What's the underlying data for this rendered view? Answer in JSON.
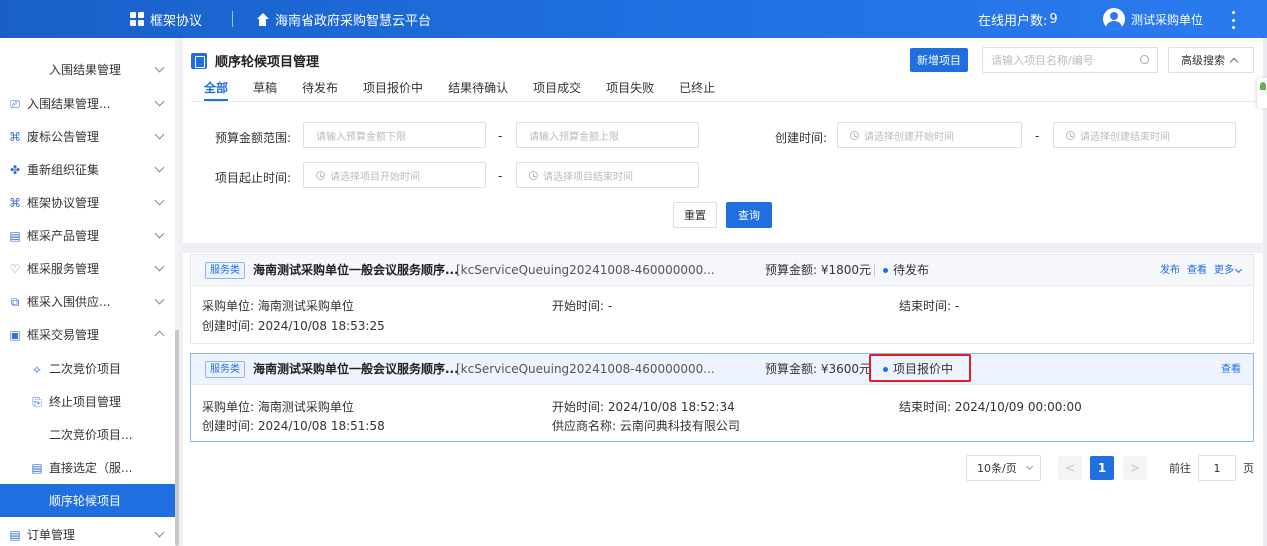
{
  "topbar": {
    "brand": "框架协议",
    "platform": "海南省政府采购智慧云平台",
    "online_label": "在线用户数:",
    "online_count": "9",
    "user_name": "测试采购单位"
  },
  "sidebar": {
    "items": [
      {
        "label": "入围结果管理",
        "icon": "none",
        "expanded": false
      },
      {
        "label": "入围结果管理...",
        "icon": "ledger-icon",
        "expanded": false
      },
      {
        "label": "废标公告管理",
        "icon": "void-doc-icon",
        "expanded": false
      },
      {
        "label": "重新组织征集",
        "icon": "clover-icon",
        "expanded": false
      },
      {
        "label": "框架协议管理",
        "icon": "agreement-icon",
        "expanded": false
      },
      {
        "label": "框采产品管理",
        "icon": "product-icon",
        "expanded": false
      },
      {
        "label": "框采服务管理",
        "icon": "service-icon",
        "expanded": false
      },
      {
        "label": "框采入围供应...",
        "icon": "supplier-icon",
        "expanded": false
      },
      {
        "label": "框采交易管理",
        "icon": "trade-icon",
        "expanded": true
      },
      {
        "label": "二次竞价项目",
        "icon": "bid-icon"
      },
      {
        "label": "终止项目管理",
        "icon": "terminate-icon"
      },
      {
        "label": "二次竞价项目...",
        "icon": "none"
      },
      {
        "label": "直接选定（服...",
        "icon": "direct-select-icon"
      },
      {
        "label": "顺序轮候项目",
        "icon": "none",
        "active": true
      },
      {
        "label": "订单管理",
        "icon": "order-icon",
        "expanded": false
      }
    ]
  },
  "page": {
    "title": "顺序轮候项目管理",
    "new_button": "新增项目",
    "search_placeholder": "请输入项目名称/编号",
    "advanced_search": "高级搜索"
  },
  "tabs": [
    "全部",
    "草稿",
    "待发布",
    "项目报价中",
    "结果待确认",
    "项目成交",
    "项目失败",
    "已终止"
  ],
  "filters": {
    "budget_label": "预算金额范围:",
    "budget_min_placeholder": "请输入预算金额下限",
    "budget_max_placeholder": "请输入预算金额上限",
    "create_time_label": "创建时间:",
    "create_start_placeholder": "请选择创建开始时间",
    "create_end_placeholder": "请选择创建结束时间",
    "project_time_label": "项目起止时间:",
    "project_start_placeholder": "请选择项目开始时间",
    "project_end_placeholder": "请选择项目结束时间",
    "range_sep": "-",
    "reset": "重置",
    "query": "查询"
  },
  "cards": [
    {
      "tag": "服务类",
      "title": "海南测试采购单位一般会议服务顺序...",
      "code": "[kcServiceQueuing20241008-460000000...",
      "budget": "预算金额: ¥1800元",
      "status": "待发布",
      "actions": [
        "发布",
        "查看",
        "更多"
      ],
      "purchaser": "采购单位: 海南测试采购单位",
      "start_time": "开始时间: -",
      "end_time": "结束时间: -",
      "created": "创建时间: 2024/10/08 18:53:25"
    },
    {
      "tag": "服务类",
      "title": "海南测试采购单位一般会议服务顺序...",
      "code": "[kcServiceQueuing20241008-460000000...",
      "budget": "预算金额: ¥3600元",
      "status": "项目报价中",
      "actions": [
        "查看"
      ],
      "purchaser": "采购单位: 海南测试采购单位",
      "start_time": "开始时间: 2024/10/08 18:52:34",
      "end_time": "结束时间: 2024/10/09 00:00:00",
      "created": "创建时间: 2024/10/08 18:51:58",
      "supplier": "供应商名称: 云南问典科技有限公司"
    }
  ],
  "pagination": {
    "page_size": "10条/页",
    "prev": "<",
    "current": "1",
    "next": ">",
    "goto_label": "前往",
    "goto_value": "1",
    "unit": "页"
  },
  "colors": {
    "primary": "#1f6fe0",
    "highlight": "#e02020"
  }
}
